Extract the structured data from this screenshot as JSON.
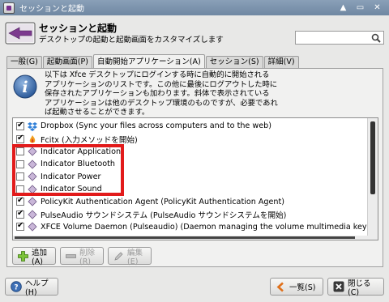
{
  "window": {
    "title": "セッションと起動",
    "controls": {
      "collapse": "▲",
      "maximize": "▭",
      "close": "✕"
    }
  },
  "header": {
    "title": "セッションと起動",
    "subtitle": "デスクトップの起動と起動画面をカスタマイズします",
    "search": {
      "value": "",
      "placeholder": ""
    }
  },
  "tabs": [
    {
      "label": "一般(G)"
    },
    {
      "label": "起動画面(P)"
    },
    {
      "label": "自動開始アプリケーション(A)",
      "active": true
    },
    {
      "label": "セッション(S)"
    },
    {
      "label": "詳細(V)"
    }
  ],
  "info": {
    "lines": [
      "以下は Xfce デスクトップにログインする時に自動的に開始される",
      "アプリケーションのリストです。この他に最後にログアウトした時に",
      "保存されたアプリケーションも加わります。斜体で表示されている",
      "アプリケーションは他のデスクトップ環境のものですが、必要であれ",
      "ば起動させることができます。"
    ]
  },
  "autostart": [
    {
      "checked": true,
      "icon": "dropbox-icon",
      "label": "Dropbox (Sync your files across computers and to the web)"
    },
    {
      "checked": true,
      "icon": "fcitx-icon",
      "label": "Fcitx (入力メソッドを開始)"
    },
    {
      "checked": false,
      "icon": "indicator-icon",
      "label": "Indicator Application"
    },
    {
      "checked": false,
      "icon": "indicator-icon",
      "label": "Indicator Bluetooth"
    },
    {
      "checked": false,
      "icon": "indicator-icon",
      "label": "Indicator Power"
    },
    {
      "checked": false,
      "icon": "indicator-icon",
      "label": "Indicator Sound"
    },
    {
      "checked": true,
      "icon": "policykit-icon",
      "label": "PolicyKit Authentication Agent (PolicyKit Authentication Agent)"
    },
    {
      "checked": true,
      "icon": "pulseaudio-icon",
      "label": "PulseAudio サウンドシステム (PulseAudio サウンドシステムを開始)"
    },
    {
      "checked": true,
      "icon": "xfce-volume-icon",
      "label": "XFCE Volume Daemon (Pulseaudio) (Daemon managing the volume multimedia keys and displa"
    }
  ],
  "buttons": {
    "add": "追加(A)",
    "remove": "削除(R)",
    "edit": "編集(E)",
    "help": "ヘルプ(H)",
    "all": "一覧(S)",
    "close": "閉じる(C)"
  },
  "colors": {
    "titlebar": "#7b92ad",
    "highlight": "#e21b1b"
  }
}
